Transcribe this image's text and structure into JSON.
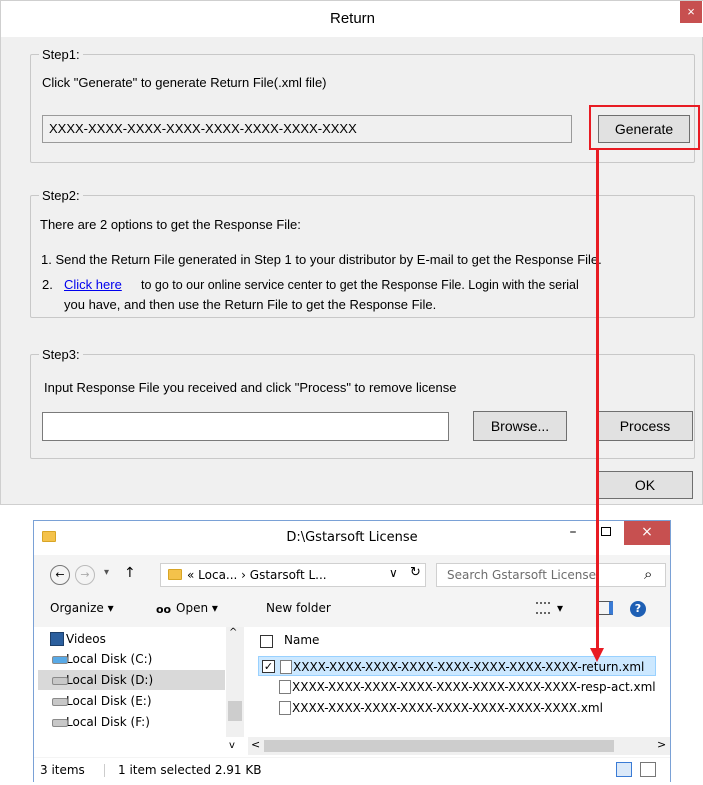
{
  "dialog": {
    "title": "Return",
    "close_glyph": "×",
    "step1": {
      "legend": "Step1:",
      "instruction": "Click \"Generate\" to generate Return File(.xml file)",
      "return_code": "XXXX-XXXX-XXXX-XXXX-XXXX-XXXX-XXXX-XXXX",
      "generate_label": "Generate"
    },
    "step2": {
      "legend": "Step2:",
      "intro": "There are 2 options to get the Response File:",
      "option1": "1.  Send the Return File generated in Step 1 to your distributor by E-mail to get the Response File.",
      "option2_num": "2.",
      "option2_link": "Click here",
      "option2_line1": "to go to our online service center to get the Response File. Login with the serial",
      "option2_line2": "you have, and then use the Return File to get the Response File."
    },
    "step3": {
      "legend": "Step3:",
      "instruction": "Input Response File you received and click \"Process\" to remove license",
      "file_value": "",
      "browse_label": "Browse...",
      "process_label": "Process"
    },
    "ok_label": "OK",
    "annotation_color": "#e81b23"
  },
  "explorer": {
    "title": "D:\\Gstarsoft License",
    "window_buttons": {
      "minimize": "–",
      "close": "×"
    },
    "nav_back": "←",
    "nav_forward": "→",
    "nav_history": "▾",
    "nav_up": "↑",
    "address": "« Loca... › Gstarsoft L...",
    "address_dropdown": "∨",
    "refresh": "↻",
    "search_placeholder": "Search Gstarsoft License",
    "search_icon": "⌕",
    "toolbar": {
      "organize": "Organize ▾",
      "open": "Open ▾",
      "new_folder": "New folder",
      "view_menu": "▾",
      "help": "?"
    },
    "nav_items": [
      {
        "label": "Videos",
        "icon": "videos-icon"
      },
      {
        "label": "Local Disk (C:)",
        "icon": "drive-icon"
      },
      {
        "label": "Local Disk (D:)",
        "icon": "drive-icon",
        "selected": true
      },
      {
        "label": "Local Disk (E:)",
        "icon": "drive-icon"
      },
      {
        "label": "Local Disk (F:)",
        "icon": "drive-icon"
      }
    ],
    "column_header": "Name",
    "files": [
      {
        "name": "XXXX-XXXX-XXXX-XXXX-XXXX-XXXX-XXXX-XXXX-return.xml",
        "selected": true,
        "checked": true
      },
      {
        "name": "XXXX-XXXX-XXXX-XXXX-XXXX-XXXX-XXXX-XXXX-resp-act.xml",
        "selected": false
      },
      {
        "name": "XXXX-XXXX-XXXX-XXXX-XXXX-XXXX-XXXX-XXXX.xml",
        "selected": false
      }
    ],
    "status": {
      "items": "3 items",
      "selection": "1 item selected  2.91 KB"
    },
    "check_glyph": "✓",
    "scroll_up": "^",
    "scroll_down": "v",
    "scroll_left": "<",
    "scroll_right": ">"
  }
}
